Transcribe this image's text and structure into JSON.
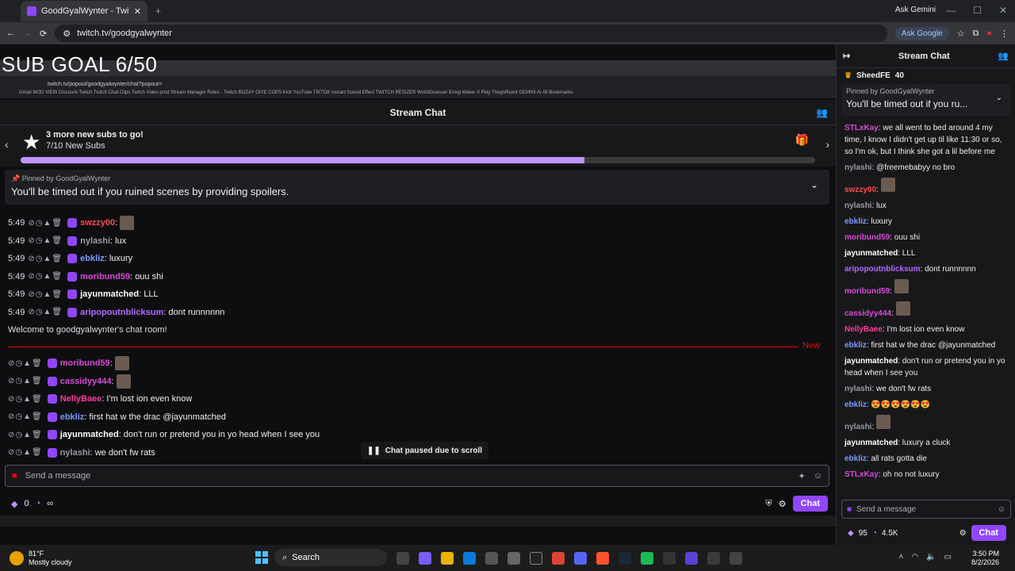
{
  "browser": {
    "tab_title": "GoodGyalWynter - Twitch",
    "url": "twitch.tv/goodgyalwynter",
    "ask_google": "Ask Google",
    "ask_gemini": "Ask Gemini"
  },
  "overlay": {
    "sub_goal": "SUB GOAL 6/50"
  },
  "inner_browser": {
    "url": "twitch.tv/popout/goodgyalwynter/chat?popout=",
    "bookmarks": "Gmail  MOD VIEW  Discount-Twitch  Twitch  Chat  Clips Twitch  Video prod  Stream Manager  Roles - Twitch  BOZAY  GIVE COPS  Kick  YouTube  TIKTOK  Instant Sound Effect  TWITCH RESIZER  WorldGuesser  Emoji Maker  X Play Thugnificent  GEMINI AI  All Bookmarks"
  },
  "chat": {
    "header": "Stream Chat",
    "goal_title": "3 more new subs to go!",
    "goal_sub": "7/10 New Subs",
    "goal_progress": 0.71,
    "pinned_by": "Pinned by",
    "pinned_user": "GoodGyalWynter",
    "pinned_msg": "You'll be timed out if you ruined scenes by providing spoilers.",
    "timestamp": "5:49",
    "welcome": "Welcome to goodgyalwynter's chat room!",
    "new_label": "New",
    "paused": "Chat paused due to scroll",
    "input_placeholder": "Send a message",
    "points": "0",
    "infinity": "∞",
    "chat_button": "Chat",
    "messages_old": [
      {
        "user": "swzzy00",
        "text": ":",
        "color": "#ff4a4a"
      },
      {
        "user": "nylashi",
        "text": ": lux",
        "color": "#9a9aa6"
      },
      {
        "user": "ebkliz",
        "text": ": luxury",
        "color": "#7a9cff"
      },
      {
        "user": "moribund59",
        "text": ": ouu shi",
        "color": "#d94ad9"
      },
      {
        "user": "jayunmatched",
        "text": ": LLL",
        "color": "#ffffff"
      },
      {
        "user": "aripopoutnblicksum",
        "text": ": dont runnnnnn",
        "color": "#b36bff"
      }
    ],
    "messages_new": [
      {
        "user": "moribund59",
        "text": ":",
        "color": "#d94ad9"
      },
      {
        "user": "cassidyy444",
        "text": ":",
        "color": "#d94ad9"
      },
      {
        "user": "NellyBaee",
        "text": ": I'm lost ion even know",
        "color": "#ff3aa0"
      },
      {
        "user": "ebkliz",
        "text": ": first hat w the drac @jayunmatched",
        "color": "#7a9cff"
      },
      {
        "user": "jayunmatched",
        "text": ": don't run or pretend you in yo head when I see you",
        "color": "#ffffff"
      },
      {
        "user": "nylashi",
        "text": ": we don't fw rats",
        "color": "#9a9aa6"
      }
    ]
  },
  "sidebar": {
    "header": "Stream Chat",
    "top_user": "SheedFE",
    "top_count": "40",
    "pinned_by": "Pinned by",
    "pinned_user": "GoodGyalWynter",
    "pinned_msg": "You'll be timed out if you ru...",
    "messages": [
      {
        "user": "STLxKay",
        "text": ": we all went to bed around 4 my time, I know I didn't get up til like 11:30 or so, so I'm ok, but I think she got a lil before me",
        "color": "#d94ad9"
      },
      {
        "user": "nylashi",
        "text": ": @freemebabyy no bro",
        "color": "#9a9aa6"
      },
      {
        "user": "swzzy00",
        "text": ":",
        "color": "#ff4a4a"
      },
      {
        "user": "nylashi",
        "text": ": lux",
        "color": "#9a9aa6"
      },
      {
        "user": "ebkliz",
        "text": ": luxury",
        "color": "#7a9cff"
      },
      {
        "user": "moribund59",
        "text": ": ouu shi",
        "color": "#d94ad9"
      },
      {
        "user": "jayunmatched",
        "text": ": LLL",
        "color": "#ffffff"
      },
      {
        "user": "aripopoutnblicksum",
        "text": ": dont runnnnnn",
        "color": "#b36bff"
      },
      {
        "user": "moribund59",
        "text": ":",
        "color": "#d94ad9"
      },
      {
        "user": "cassidyy444",
        "text": ":",
        "color": "#d94ad9"
      },
      {
        "user": "NellyBaee",
        "text": ": I'm lost ion even know",
        "color": "#ff3aa0"
      },
      {
        "user": "ebkliz",
        "text": ": first hat w the drac @jayunmatched",
        "color": "#7a9cff"
      },
      {
        "user": "jayunmatched",
        "text": ": don't run or pretend you in yo head when I see you",
        "color": "#ffffff"
      },
      {
        "user": "nylashi",
        "text": ": we don't fw rats",
        "color": "#9a9aa6"
      },
      {
        "user": "ebkliz",
        "text": ": 😍😍😍😍😍😍",
        "color": "#7a9cff"
      },
      {
        "user": "nylashi",
        "text": ":",
        "color": "#9a9aa6"
      },
      {
        "user": "jayunmatched",
        "text": ": luxury a cluck",
        "color": "#ffffff"
      },
      {
        "user": "ebkliz",
        "text": ": all rats gotta die",
        "color": "#7a9cff"
      },
      {
        "user": "STLxKay",
        "text": ": oh no not luxury",
        "color": "#d94ad9"
      }
    ],
    "input_placeholder": "Send a message",
    "points": "95",
    "viewers": "4.5K",
    "chat_button": "Chat"
  },
  "taskbar": {
    "temp": "81°F",
    "weather": "Mostly cloudy",
    "search": "Search",
    "time": "3:50 PM",
    "date": "8/2/2026"
  }
}
